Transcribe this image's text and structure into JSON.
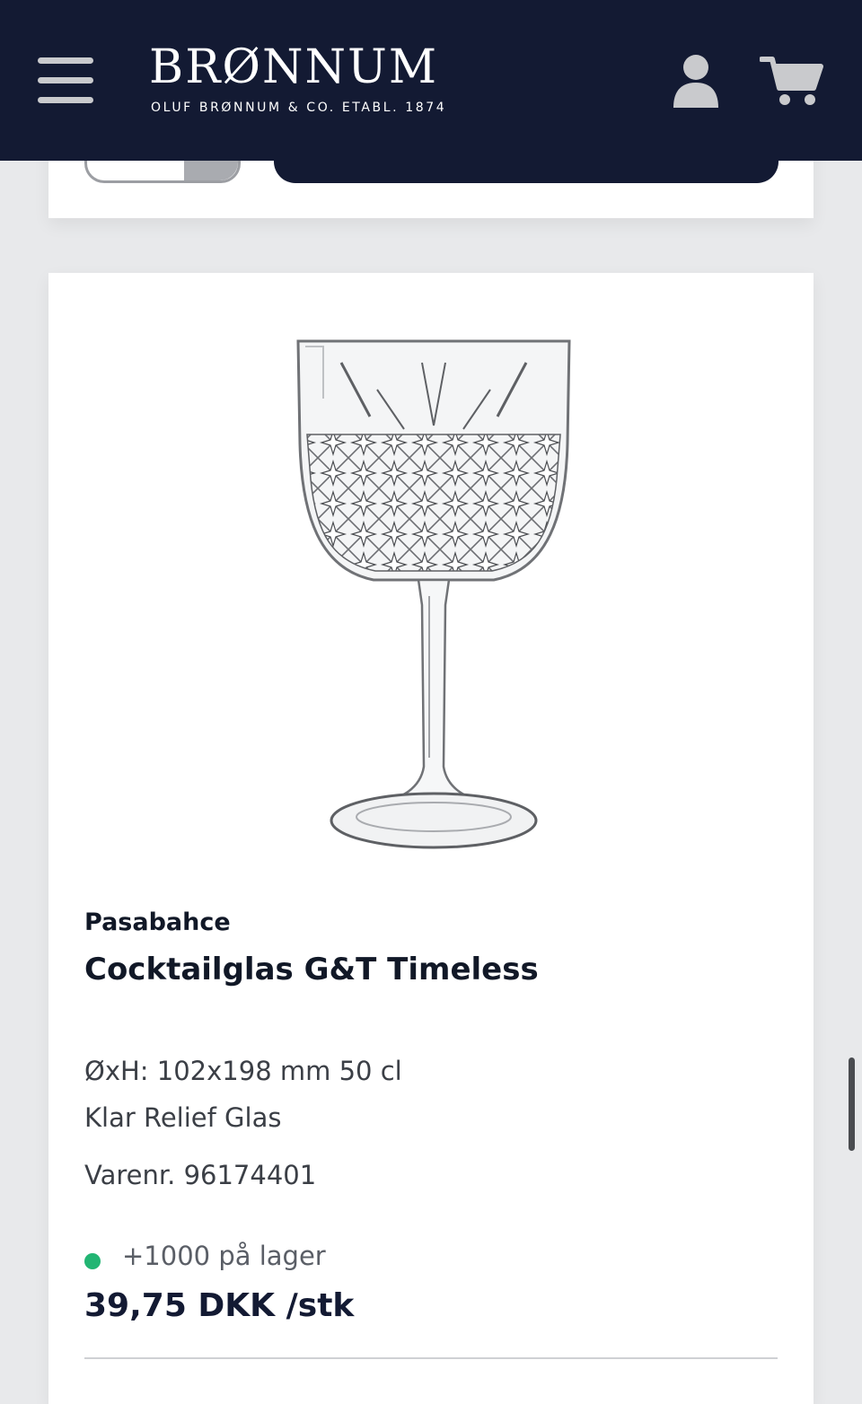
{
  "header": {
    "brand_title": "BRØNNUM",
    "brand_subtitle": "OLUF BRØNNUM & CO.   ETABL. 1874",
    "background": "#131a33",
    "icons": {
      "menu": "hamburger-menu-icon",
      "account": "user-icon",
      "cart": "shopping-cart-icon"
    }
  },
  "product": {
    "brand": "Pasabahce",
    "title": "Cocktailglas G&T Timeless",
    "dimensions": "ØxH: 102x198 mm 50 cl",
    "material": "Klar Relief Glas",
    "sku": "Varenr. 96174401",
    "stock": "+1000 på lager",
    "stock_color": "#22b573",
    "price": "39,75 DKK /stk"
  }
}
